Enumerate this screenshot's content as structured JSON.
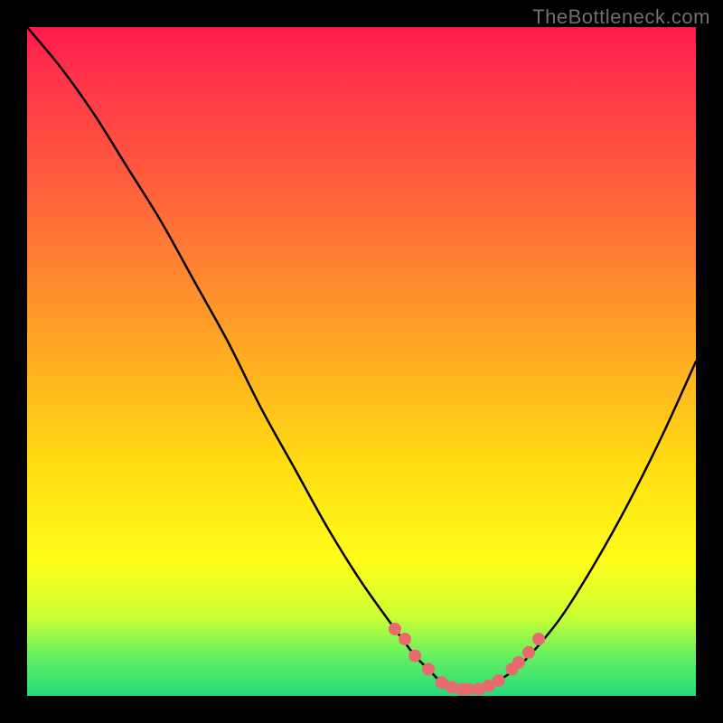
{
  "watermark": "TheBottleneck.com",
  "chart_data": {
    "type": "line",
    "title": "",
    "xlabel": "",
    "ylabel": "",
    "xlim": [
      0,
      100
    ],
    "ylim": [
      0,
      100
    ],
    "series": [
      {
        "name": "bottleneck-curve",
        "x": [
          0,
          5,
          10,
          15,
          20,
          25,
          30,
          35,
          40,
          45,
          50,
          55,
          58,
          60,
          62,
          64,
          66,
          68,
          70,
          73,
          76,
          80,
          85,
          90,
          95,
          100
        ],
        "y": [
          100,
          94,
          87,
          79,
          71,
          62,
          53,
          43,
          34,
          25,
          17,
          10,
          6,
          4,
          2,
          1,
          1,
          1,
          2,
          4,
          7,
          12,
          20,
          29,
          39,
          50
        ]
      }
    ],
    "markers": {
      "name": "highlight-dots",
      "color": "#e86a6f",
      "x": [
        55,
        56.5,
        58,
        60,
        62,
        63.5,
        65,
        66,
        67.5,
        69,
        70.5,
        72.5,
        73.5,
        75,
        76.5
      ],
      "y": [
        10,
        8.5,
        6,
        4,
        2,
        1.3,
        1,
        1,
        1,
        1.5,
        2.3,
        4,
        5,
        6.5,
        8.5
      ]
    }
  }
}
